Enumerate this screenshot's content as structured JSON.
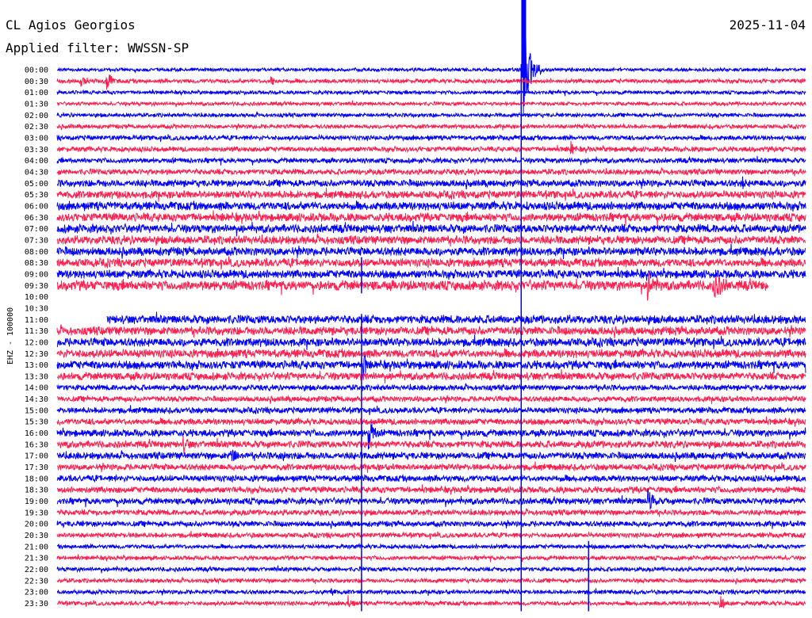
{
  "header": {
    "station": "CL Agios Georgios",
    "filter": "Applied filter: WWSSN-SP",
    "date": "2025-11-04"
  },
  "chart_data": {
    "type": "line",
    "title": "CL Agios Georgios",
    "ylabel": "EHZ - 100000",
    "row_labels": [
      "00:00",
      "00:30",
      "01:00",
      "01:30",
      "02:00",
      "02:30",
      "03:00",
      "03:30",
      "04:00",
      "04:30",
      "05:00",
      "05:30",
      "06:00",
      "06:30",
      "07:00",
      "07:30",
      "08:00",
      "08:30",
      "09:00",
      "09:30",
      "10:00",
      "10:30",
      "11:00",
      "11:30",
      "12:00",
      "12:30",
      "13:00",
      "13:30",
      "14:00",
      "14:30",
      "15:00",
      "15:30",
      "16:00",
      "16:30",
      "17:00",
      "17:30",
      "18:00",
      "18:30",
      "19:00",
      "19:30",
      "20:00",
      "20:30",
      "21:00",
      "21:30",
      "22:00",
      "22:30",
      "23:00",
      "23:30"
    ],
    "row_colors": [
      "#0000ff",
      "#ff2050"
    ],
    "noise_amplitude": [
      2.4,
      3,
      2.6,
      2.6,
      2.8,
      3,
      3.4,
      3.6,
      3.6,
      4,
      5,
      5.5,
      6,
      6,
      6,
      6,
      6,
      6,
      6,
      7,
      0,
      0,
      6,
      6,
      6,
      6,
      6,
      5.5,
      4,
      4,
      4.2,
      4.5,
      5,
      5,
      5,
      4.5,
      4.5,
      4.5,
      4.5,
      4,
      4,
      3.5,
      3,
      3,
      3,
      3,
      3,
      3
    ],
    "gaps": [
      {
        "row": 19,
        "from_min": 28.5,
        "to_min": 30
      },
      {
        "row": 20,
        "from_min": 0,
        "to_min": 30
      },
      {
        "row": 21,
        "from_min": 0,
        "to_min": 30
      },
      {
        "row": 22,
        "from_min": 0,
        "to_min": 2
      }
    ],
    "events": [
      {
        "row": 0,
        "min": 18.7,
        "amp": 60,
        "dur": 0.8,
        "note": "large local event"
      },
      {
        "row": 1,
        "min": 1.0,
        "amp": 10,
        "dur": 0.4
      },
      {
        "row": 1,
        "min": 2.0,
        "amp": 14,
        "dur": 0.6
      },
      {
        "row": 1,
        "min": 8.6,
        "amp": 8,
        "dur": 0.4
      },
      {
        "row": 7,
        "min": 20.6,
        "amp": 12,
        "dur": 0.5
      },
      {
        "row": 10,
        "min": 27.5,
        "amp": 8,
        "dur": 0.4
      },
      {
        "row": 19,
        "min": 23.7,
        "amp": 18,
        "dur": 1.2
      },
      {
        "row": 19,
        "min": 26.3,
        "amp": 20,
        "dur": 1.4
      },
      {
        "row": 26,
        "min": 12.3,
        "amp": 16,
        "dur": 0.5
      },
      {
        "row": 32,
        "min": 12.5,
        "amp": 20,
        "dur": 0.7
      },
      {
        "row": 33,
        "min": 5.1,
        "amp": 12,
        "dur": 0.7
      },
      {
        "row": 34,
        "min": 7.0,
        "amp": 12,
        "dur": 0.8
      },
      {
        "row": 34,
        "min": 9.0,
        "amp": 10,
        "dur": 0.8
      },
      {
        "row": 38,
        "min": 23.7,
        "amp": 16,
        "dur": 0.8
      },
      {
        "row": 46,
        "min": 11.0,
        "amp": 8,
        "dur": 0.5
      },
      {
        "row": 47,
        "min": 11.7,
        "amp": 10,
        "dur": 0.5
      },
      {
        "row": 47,
        "min": 26.6,
        "amp": 10,
        "dur": 0.5
      }
    ],
    "glitches": [
      {
        "min": 18.6,
        "from_row": 0,
        "to_row": 47
      },
      {
        "min": 12.2,
        "from_row": 22,
        "to_row": 47
      },
      {
        "min": 12.2,
        "from_row": 17,
        "to_row": 19
      },
      {
        "min": 21.3,
        "from_row": 42,
        "to_row": 47
      }
    ],
    "x_unit": "minutes within 30-minute row",
    "xlim": [
      0,
      30
    ],
    "grid": false,
    "legend": "none"
  }
}
